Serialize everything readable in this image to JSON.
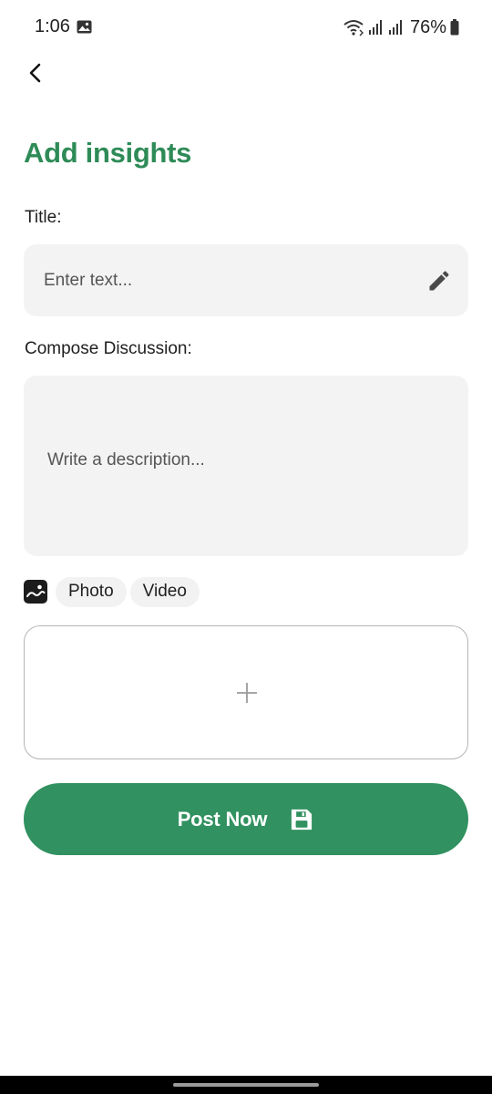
{
  "status_bar": {
    "time": "1:06",
    "battery": "76%",
    "icons": [
      "gallery-icon",
      "wifi-icon",
      "signal-icon",
      "signal-icon",
      "battery-icon"
    ]
  },
  "header": {
    "back_icon": "chevron-left-icon",
    "title": "Add insights"
  },
  "form": {
    "title_label": "Title:",
    "title_value": "",
    "title_placeholder": "Enter text...",
    "title_icon": "pencil-icon",
    "compose_label": "Compose Discussion:",
    "description_value": "",
    "description_placeholder": "Write a description...",
    "media_icon": "image-icon",
    "media_options": [
      "Photo",
      "Video"
    ],
    "upload_icon": "plus-icon"
  },
  "actions": {
    "post_label": "Post Now",
    "post_icon": "save-icon"
  },
  "colors": {
    "accent": "#2e8b57",
    "button": "#319160",
    "field_background": "#f3f3f3"
  }
}
